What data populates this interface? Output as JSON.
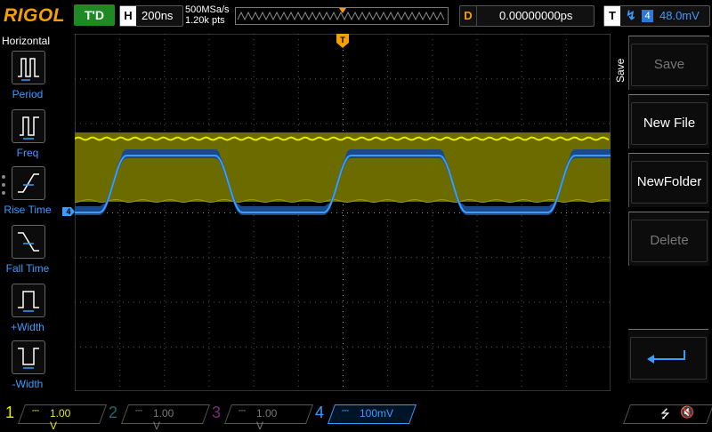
{
  "brand": "RIGOL",
  "run_state": "T'D",
  "horizontal": {
    "tag": "H",
    "timebase": "200ns"
  },
  "sample": {
    "rate": "500MSa/s",
    "points": "1.20k pts"
  },
  "delay": {
    "tag": "D",
    "value": "0.00000000ps"
  },
  "trigger": {
    "tag": "T",
    "edge_icon": "rising-edge-icon",
    "source": "4",
    "level": "48.0mV",
    "marker": "T"
  },
  "left_menu": {
    "title": "Horizontal",
    "items": [
      {
        "label": "Period",
        "icon": "period-icon"
      },
      {
        "label": "Freq",
        "icon": "frequency-icon"
      },
      {
        "label": "Rise Time",
        "icon": "rise-time-icon"
      },
      {
        "label": "Fall Time",
        "icon": "fall-time-icon"
      },
      {
        "label": "+Width",
        "icon": "positive-width-icon"
      },
      {
        "label": "-Width",
        "icon": "negative-width-icon"
      }
    ]
  },
  "right_menu": {
    "title": "Save",
    "buttons": [
      {
        "label": "Save",
        "enabled": false
      },
      {
        "label": "New File",
        "enabled": true
      },
      {
        "label": "NewFolder",
        "enabled": true
      },
      {
        "label": "Delete",
        "enabled": false
      }
    ],
    "return_icon": "return-arrow-icon"
  },
  "channels": [
    {
      "num": "1",
      "scale": "1.00 V",
      "coupling": "DC",
      "active": true
    },
    {
      "num": "2",
      "scale": "1.00 V",
      "coupling": "DC",
      "active": false
    },
    {
      "num": "3",
      "scale": "1.00 V",
      "coupling": "DC",
      "active": false
    },
    {
      "num": "4",
      "scale": "100mV",
      "coupling": "DC",
      "active": true
    }
  ],
  "markers": {
    "ch4_label": "4"
  },
  "status_icons": [
    "usb-icon",
    "speaker-muted-icon"
  ],
  "colors": {
    "ch1": "#e8e800",
    "ch4": "#3a9cff",
    "brand": "#f5a000",
    "trigger": "#f5a000",
    "run_state": "#1f8a24"
  }
}
